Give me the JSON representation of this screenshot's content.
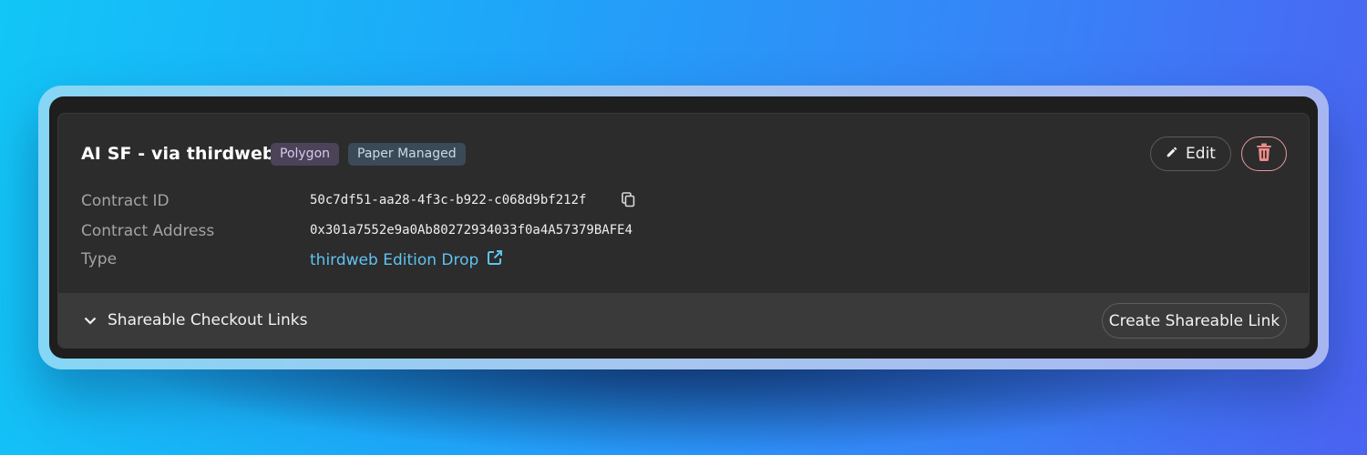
{
  "card": {
    "title": "AI SF - via thirdweb",
    "badges": [
      "Polygon",
      "Paper Managed"
    ],
    "actions": {
      "edit_label": "Edit"
    }
  },
  "details": [
    {
      "label": "Contract ID",
      "value": "50c7df51-aa28-4f3c-b922-c068d9bf212f"
    },
    {
      "label": "Contract Address",
      "value": "0x301a7552e9a0Ab80272934033f0a4A57379BAFE4"
    },
    {
      "label": "Type",
      "value": "thirdweb Edition Drop"
    }
  ],
  "footer": {
    "toggle_label": "Shareable Checkout Links",
    "create_label": "Create Shareable Link"
  },
  "icons": {
    "edit": "pencil-icon",
    "delete": "trash-icon",
    "copy": "copy-icon",
    "external": "external-link-icon",
    "toggle": "chevron-down-icon"
  },
  "colors": {
    "link": "#5fc3f2",
    "delete_accent": "#e89a9a",
    "card_background": "#2c2c2c"
  }
}
